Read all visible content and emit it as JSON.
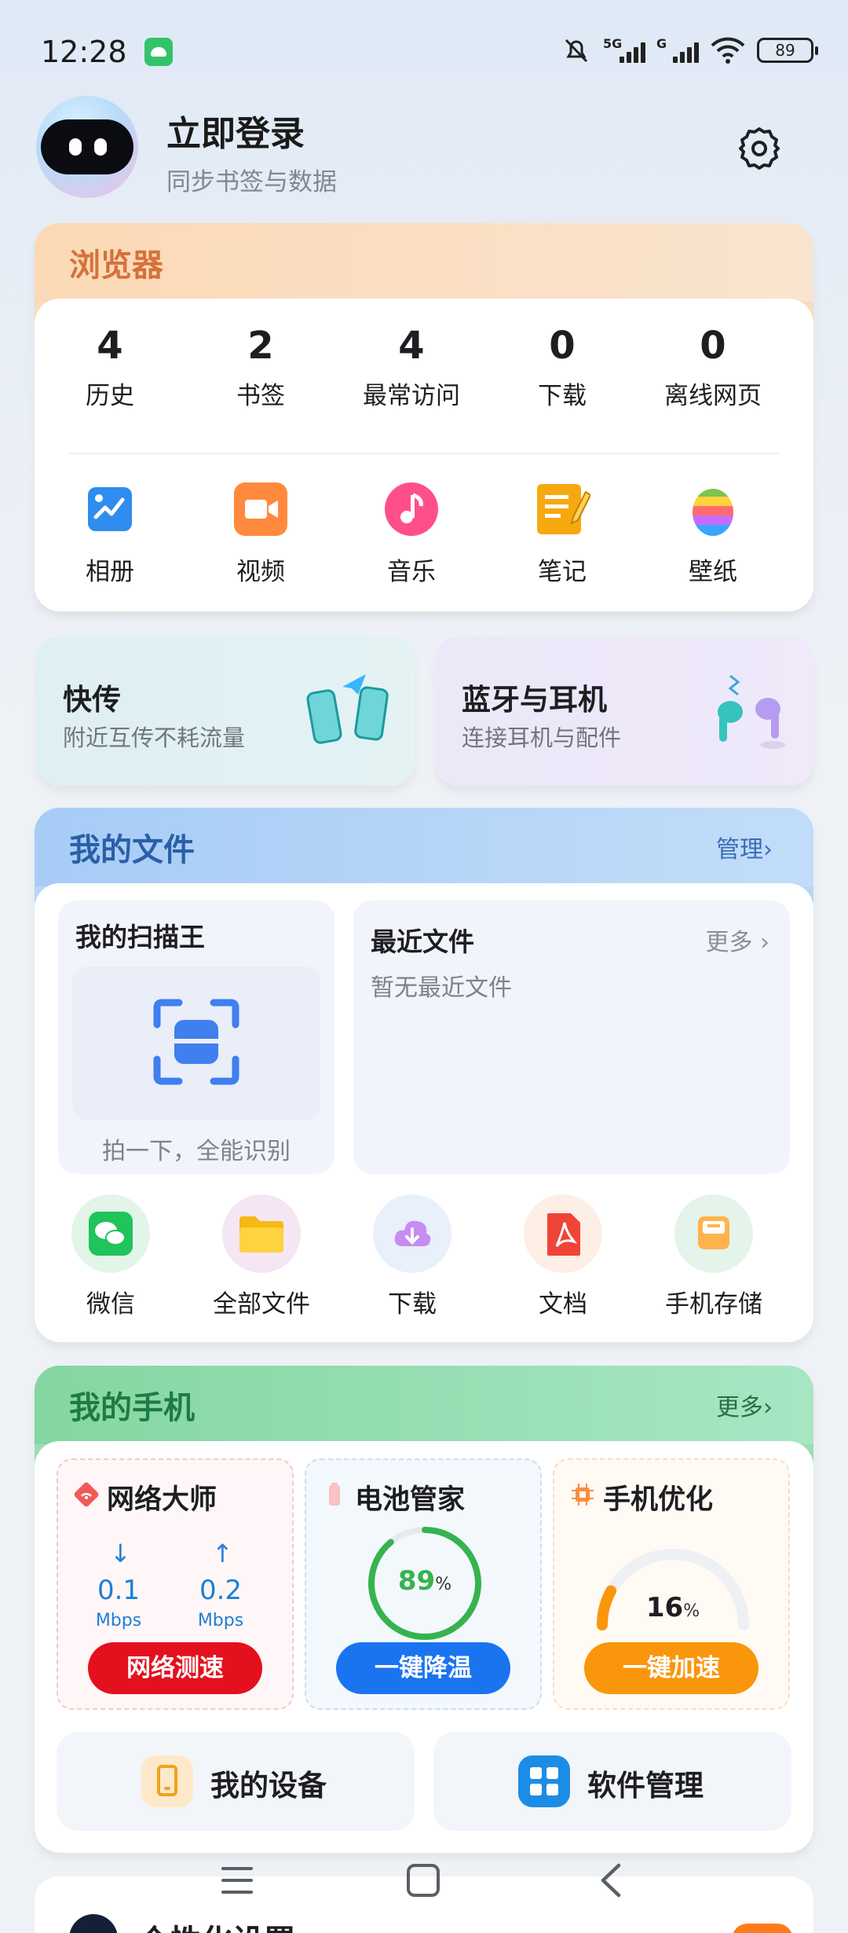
{
  "status_bar": {
    "time": "12:28",
    "signal1_label": "5G",
    "signal2_label": "G",
    "battery": "89"
  },
  "header": {
    "title": "立即登录",
    "subtitle": "同步书签与数据"
  },
  "browser": {
    "title": "浏览器",
    "stats": [
      {
        "value": "4",
        "label": "历史"
      },
      {
        "value": "2",
        "label": "书签"
      },
      {
        "value": "4",
        "label": "最常访问"
      },
      {
        "value": "0",
        "label": "下载"
      },
      {
        "value": "0",
        "label": "离线网页"
      }
    ],
    "apps": [
      {
        "label": "相册",
        "icon": "album-icon",
        "color": "#2f8df0"
      },
      {
        "label": "视频",
        "icon": "video-icon",
        "color": "#ff8a3d"
      },
      {
        "label": "音乐",
        "icon": "music-icon",
        "color": "#ff4f8b"
      },
      {
        "label": "笔记",
        "icon": "note-icon",
        "color": "#f6a90f"
      },
      {
        "label": "壁纸",
        "icon": "wallpaper-icon",
        "color": "#7cc44a"
      }
    ]
  },
  "quick": {
    "transfer": {
      "title": "快传",
      "subtitle": "附近互传不耗流量"
    },
    "bluetooth": {
      "title": "蓝牙与耳机",
      "subtitle": "连接耳机与配件"
    }
  },
  "files": {
    "title": "我的文件",
    "manage": "管理",
    "scanner": {
      "title": "我的扫描王",
      "caption": "拍一下，全能识别"
    },
    "recent": {
      "title": "最近文件",
      "more": "更多",
      "empty": "暂无最近文件"
    },
    "apps": [
      {
        "label": "微信",
        "icon": "wechat-icon"
      },
      {
        "label": "全部文件",
        "icon": "folder-icon"
      },
      {
        "label": "下载",
        "icon": "download-icon"
      },
      {
        "label": "文档",
        "icon": "pdf-icon"
      },
      {
        "label": "手机存储",
        "icon": "storage-icon"
      }
    ]
  },
  "phone": {
    "title": "我的手机",
    "more": "更多",
    "network": {
      "title": "网络大师",
      "down_value": "0.1",
      "up_value": "0.2",
      "down_unit": "Mbps",
      "up_unit": "Mbps",
      "button": "网络测速"
    },
    "battery": {
      "title": "电池管家",
      "value": "89",
      "unit": "%",
      "level": 0.89,
      "button": "一键降温"
    },
    "optimize": {
      "title": "手机优化",
      "value": "16",
      "unit": "%",
      "level": 0.16,
      "button": "一键加速"
    },
    "device": "我的设备",
    "software": "软件管理"
  },
  "peek": {
    "title": "个性化设置"
  },
  "colors": {
    "red": "#e5101e",
    "blue": "#1a74f0",
    "orange": "#f9960c",
    "green": "#36b34f"
  }
}
